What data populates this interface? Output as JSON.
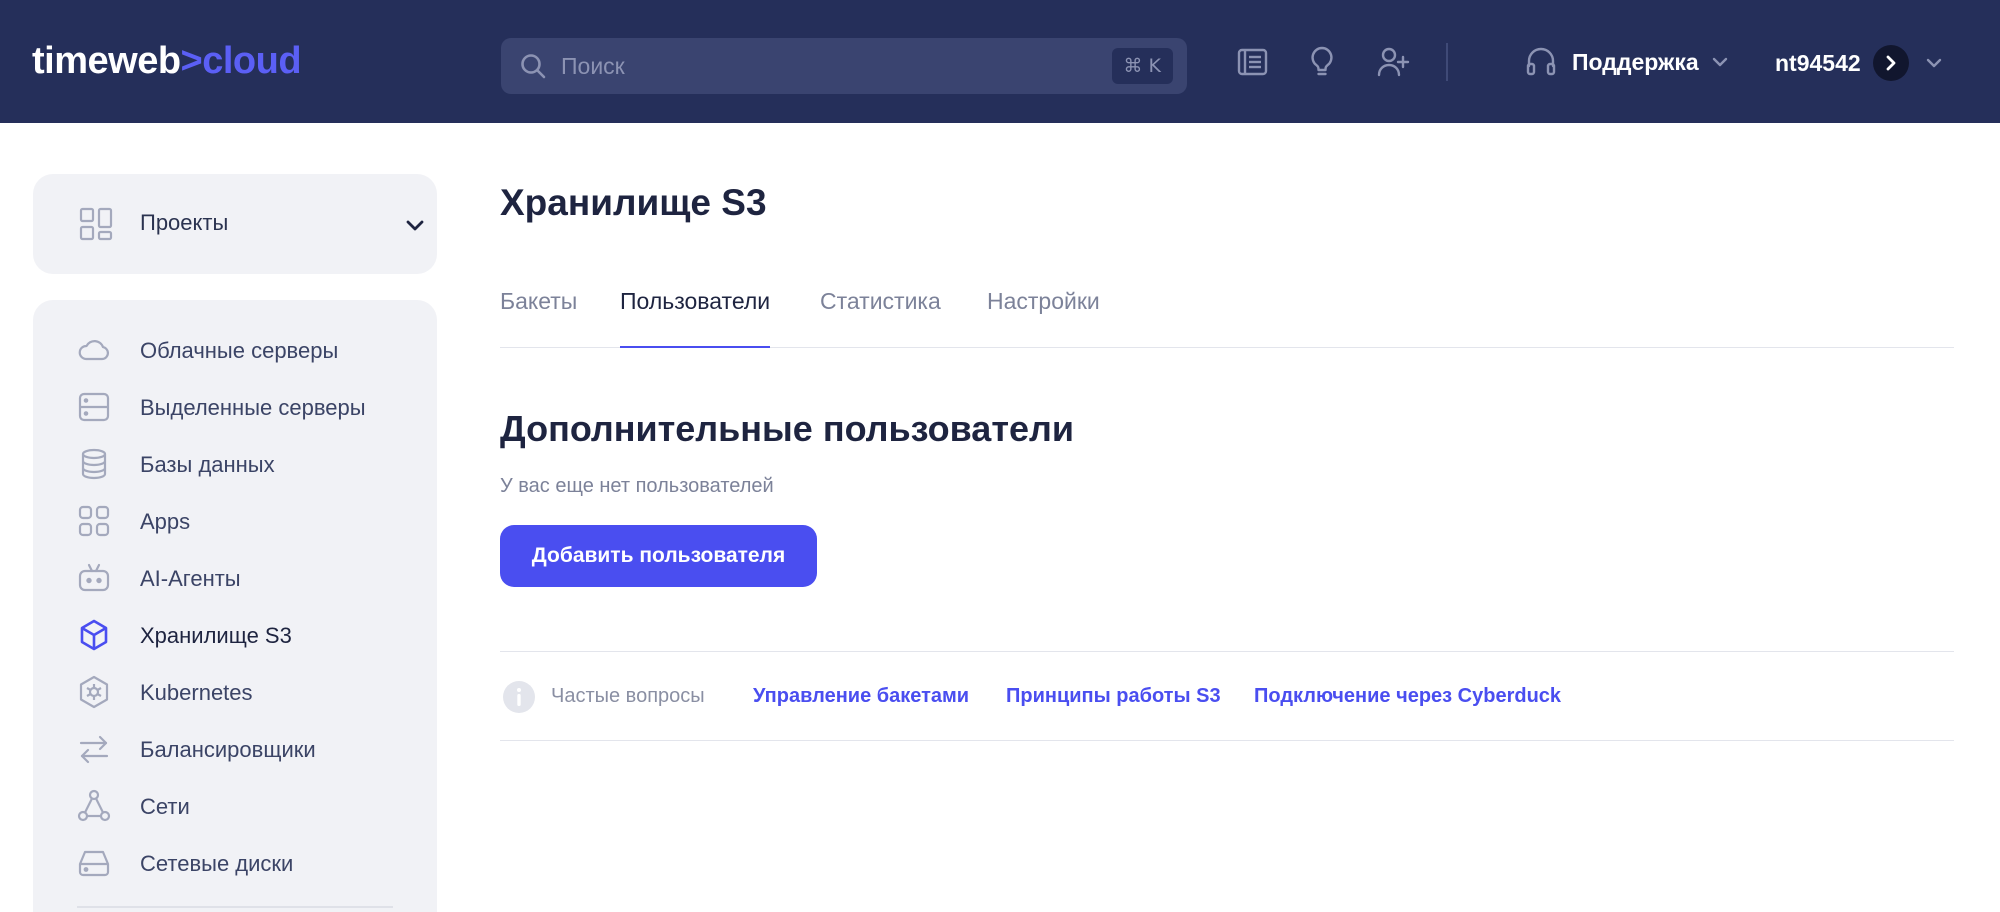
{
  "header": {
    "logo_main": "timeweb",
    "logo_accent": ">cloud",
    "search_placeholder": "Поиск",
    "search_shortcut": "⌘ K",
    "support_label": "Поддержка",
    "user_name": "nt94542"
  },
  "sidebar": {
    "projects_label": "Проекты",
    "items": [
      {
        "label": "Облачные серверы",
        "icon": "cloud-icon"
      },
      {
        "label": "Выделенные серверы",
        "icon": "server-icon"
      },
      {
        "label": "Базы данных",
        "icon": "database-icon"
      },
      {
        "label": "Apps",
        "icon": "apps-icon"
      },
      {
        "label": "AI-Агенты",
        "icon": "robot-icon"
      },
      {
        "label": "Хранилище S3",
        "icon": "cube-icon",
        "active": true
      },
      {
        "label": "Kubernetes",
        "icon": "kubernetes-icon"
      },
      {
        "label": "Балансировщики",
        "icon": "arrows-icon"
      },
      {
        "label": "Сети",
        "icon": "network-icon"
      },
      {
        "label": "Сетевые диски",
        "icon": "disk-icon"
      }
    ]
  },
  "main": {
    "title": "Хранилище S3",
    "tabs": [
      {
        "label": "Бакеты"
      },
      {
        "label": "Пользователи",
        "active": true
      },
      {
        "label": "Статистика"
      },
      {
        "label": "Настройки"
      }
    ],
    "section_title": "Дополнительные пользователи",
    "empty_text": "У вас еще нет пользователей",
    "add_button": "Добавить пользователя",
    "faq": {
      "label": "Частые вопросы",
      "links": [
        "Управление бакетами",
        "Принципы работы S3",
        "Подключение через Cyberduck"
      ]
    }
  },
  "colors": {
    "header_bg": "#252f5a",
    "accent": "#4a4ef0",
    "sidebar_bg": "#f1f2f6"
  }
}
